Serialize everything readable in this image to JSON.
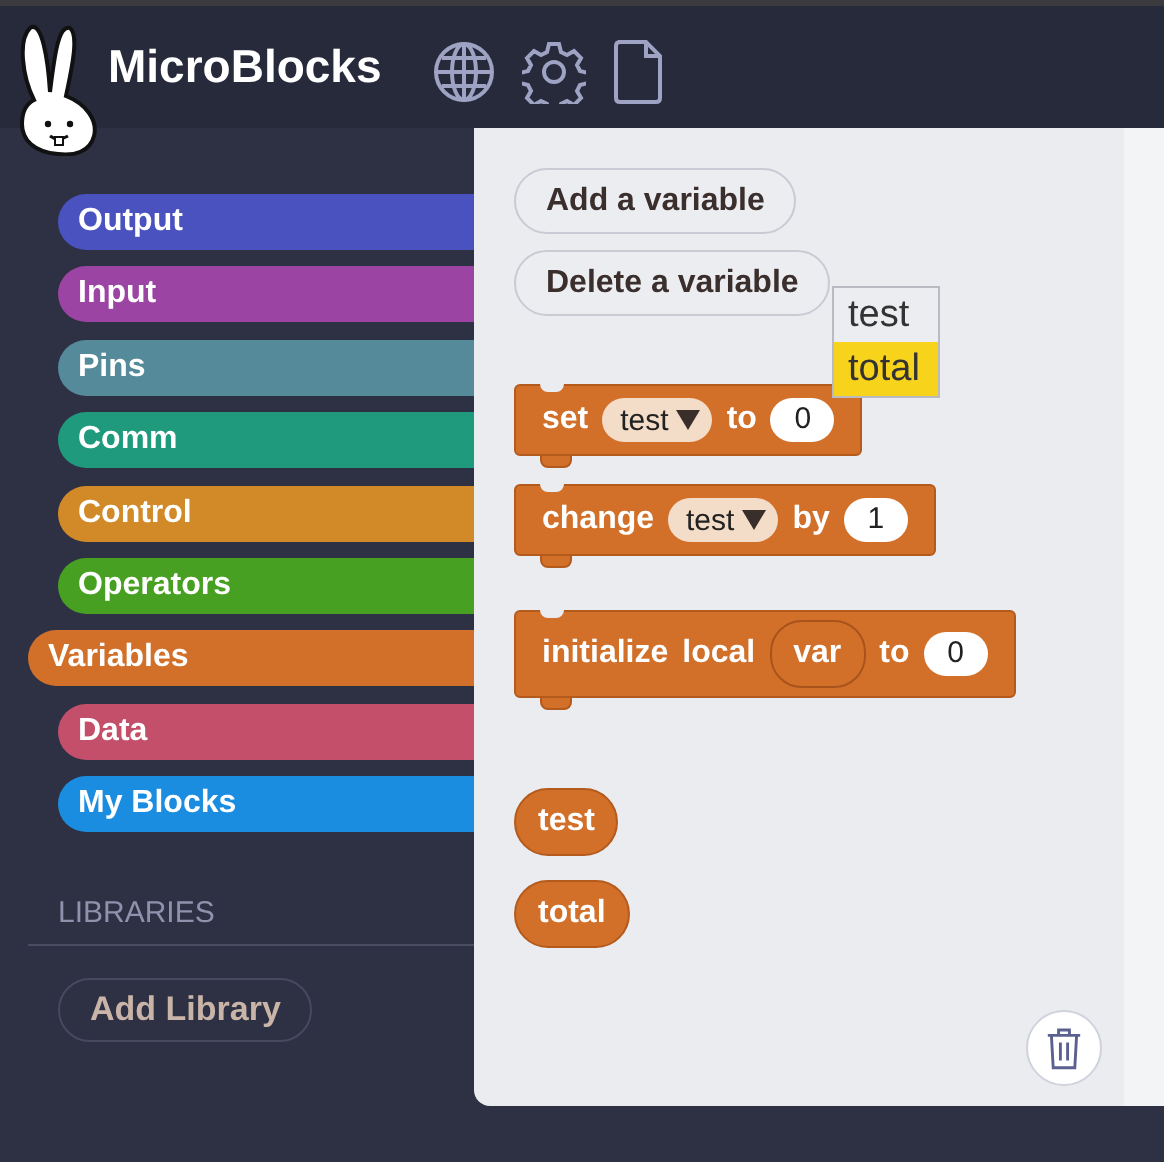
{
  "app": {
    "title": "MicroBlocks"
  },
  "categories": [
    {
      "label": "Output",
      "selected": false,
      "color": "#4a52c0"
    },
    {
      "label": "Input",
      "selected": false,
      "color": "#9c44a4"
    },
    {
      "label": "Pins",
      "selected": false,
      "color": "#548a9a"
    },
    {
      "label": "Comm",
      "selected": false,
      "color": "#1f9a7c"
    },
    {
      "label": "Control",
      "selected": false,
      "color": "#d18a27"
    },
    {
      "label": "Operators",
      "selected": false,
      "color": "#48a022"
    },
    {
      "label": "Variables",
      "selected": true,
      "color": "#d2702a"
    },
    {
      "label": "Data",
      "selected": false,
      "color": "#c44f6b"
    },
    {
      "label": "My Blocks",
      "selected": false,
      "color": "#1b8de0"
    }
  ],
  "libraries": {
    "heading": "LIBRARIES",
    "button": "Add Library"
  },
  "palette": {
    "buttons": [
      "Add a variable",
      "Delete a variable"
    ],
    "menu": [
      {
        "label": "test",
        "selected": false
      },
      {
        "label": "total",
        "selected": true
      }
    ],
    "blocks": [
      {
        "kind": "command",
        "parts": [
          {
            "kind": "word",
            "text": "set"
          },
          {
            "kind": "dropdown",
            "text": "test"
          },
          {
            "kind": "word",
            "text": "to"
          },
          {
            "kind": "number",
            "text": "0"
          }
        ]
      },
      {
        "kind": "command",
        "parts": [
          {
            "kind": "word",
            "text": "change"
          },
          {
            "kind": "dropdown",
            "text": "test"
          },
          {
            "kind": "word",
            "text": "by"
          },
          {
            "kind": "number",
            "text": "1"
          }
        ]
      },
      {
        "kind": "command",
        "parts": [
          {
            "kind": "word",
            "text": "initialize"
          },
          {
            "kind": "word",
            "text": "local"
          },
          {
            "kind": "variable",
            "text": "var"
          },
          {
            "kind": "word",
            "text": "to"
          },
          {
            "kind": "number",
            "text": "0"
          }
        ]
      },
      {
        "kind": "reporter",
        "parts": [
          {
            "kind": "word",
            "text": "test"
          }
        ]
      },
      {
        "kind": "reporter",
        "parts": [
          {
            "kind": "word",
            "text": "total"
          }
        ]
      }
    ]
  }
}
